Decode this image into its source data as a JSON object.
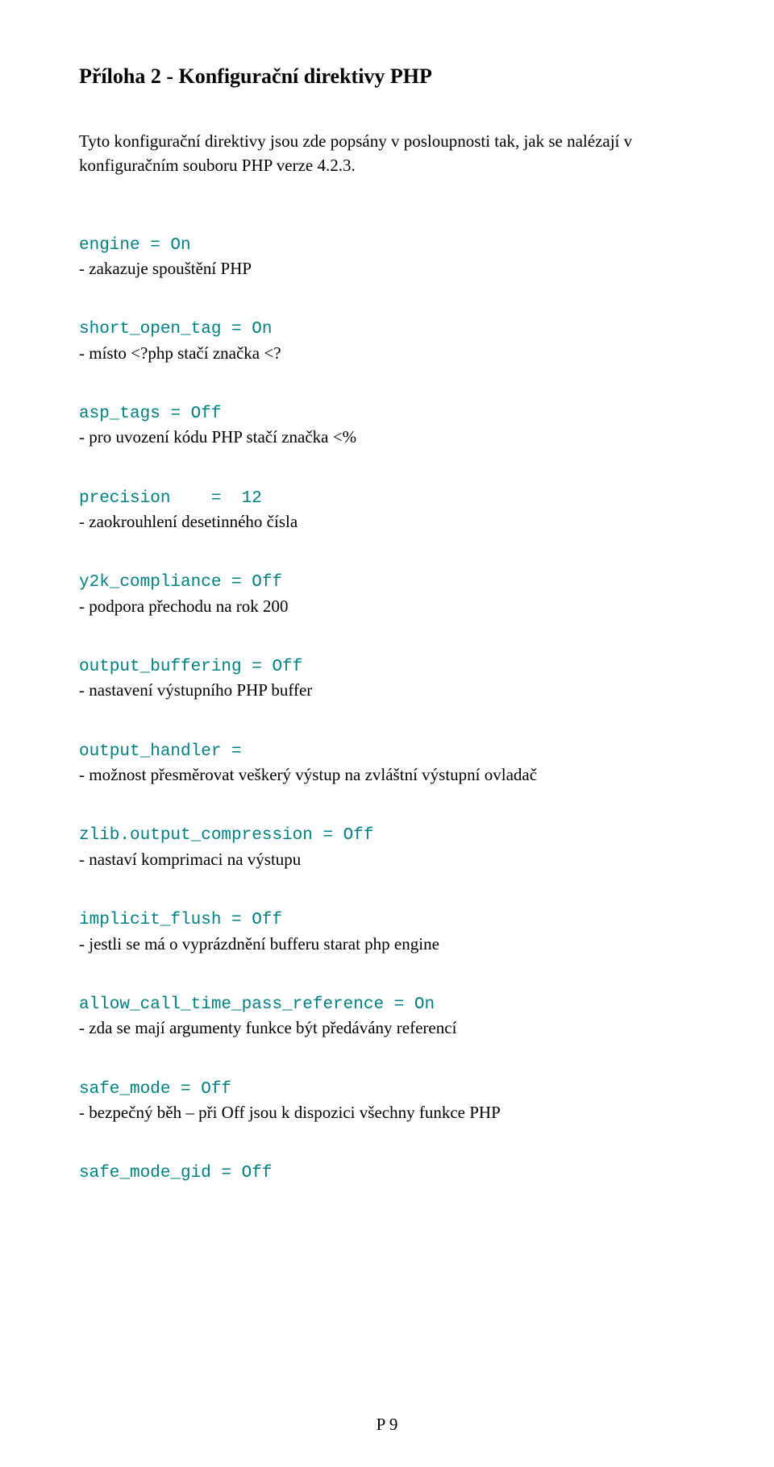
{
  "title": "Příloha 2 - Konfigurační direktivy PHP",
  "intro": "Tyto konfigurační direktivy jsou zde popsány v posloupnosti tak, jak se nalézají v konfiguračním souboru PHP verze 4.2.3.",
  "entries": [
    {
      "code": "engine = On",
      "desc": "- zakazuje spouštění PHP"
    },
    {
      "code": "short_open_tag = On",
      "desc": "- místo <?php stačí značka <?"
    },
    {
      "code": "asp_tags = Off",
      "desc": "- pro uvození kódu PHP stačí značka <%"
    },
    {
      "code": "precision    =  12",
      "desc": "- zaokrouhlení desetinného čísla"
    },
    {
      "code": "y2k_compliance = Off",
      "desc": "- podpora přechodu na rok 200"
    },
    {
      "code": "output_buffering = Off",
      "desc": "- nastavení výstupního PHP buffer"
    },
    {
      "code": "output_handler =",
      "desc": "- možnost přesměrovat veškerý výstup na zvláštní výstupní ovladač"
    },
    {
      "code": "zlib.output_compression = Off",
      "desc": "- nastaví komprimaci na výstupu"
    },
    {
      "code": "implicit_flush = Off",
      "desc": "- jestli se má o vyprázdnění bufferu starat php engine"
    },
    {
      "code": "allow_call_time_pass_reference = On",
      "desc": "- zda se mají argumenty funkce být předávány referencí"
    },
    {
      "code": "safe_mode = Off",
      "desc": "- bezpečný běh – při Off jsou k dispozici všechny funkce PHP"
    },
    {
      "code": "safe_mode_gid = Off",
      "desc": ""
    }
  ],
  "footer": "P 9"
}
